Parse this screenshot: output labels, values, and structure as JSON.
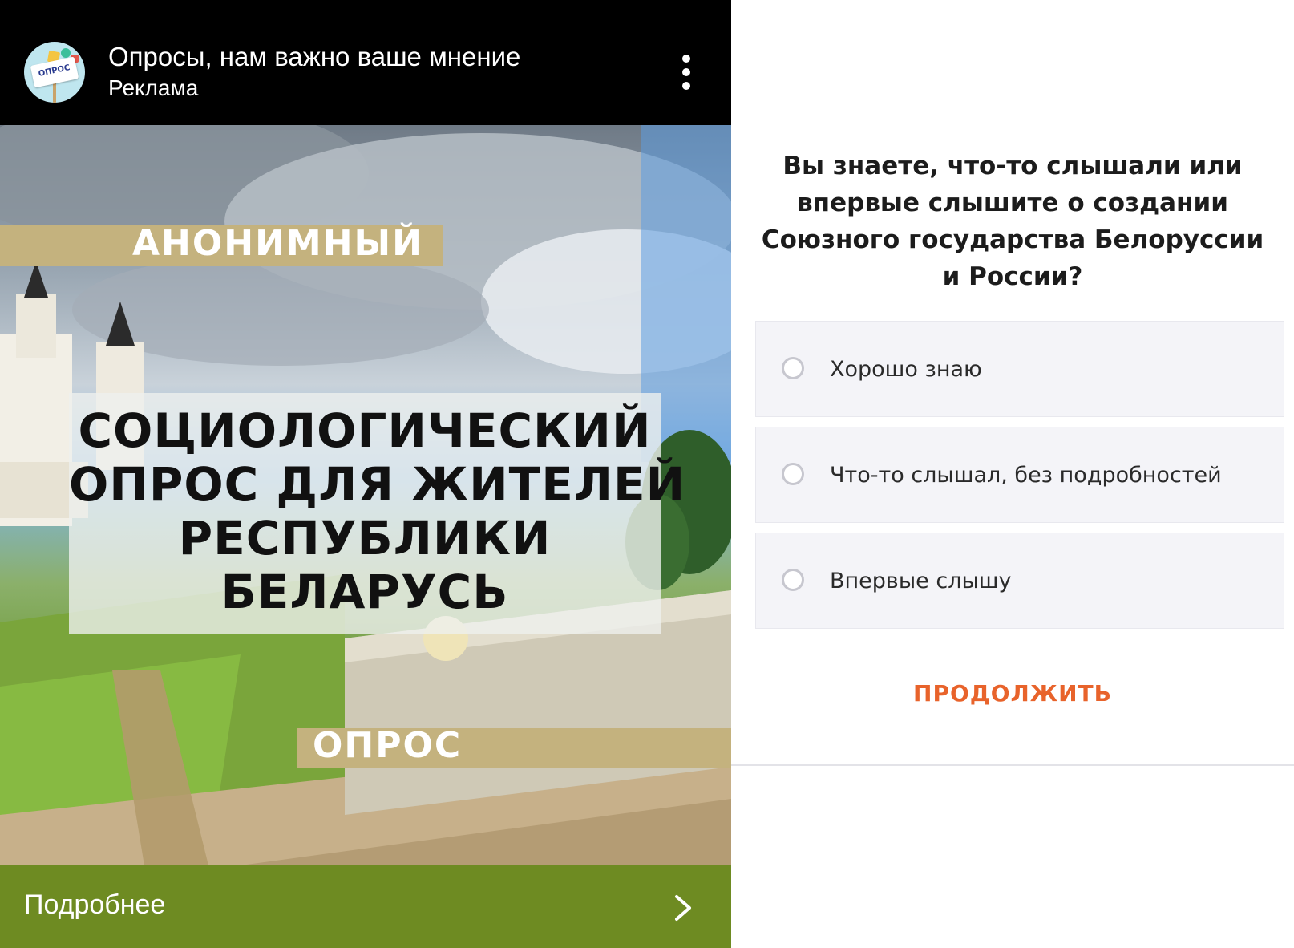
{
  "ad": {
    "title": "Опросы, нам важно ваше мнение",
    "subtitle": "Реклама",
    "avatar_text": "ОПРОС",
    "image": {
      "band_top": "АНОНИМНЫЙ",
      "headline_lines": [
        "СОЦИОЛОГИЧЕСКИЙ",
        "ОПРОС ДЛЯ ЖИТЕЛЕЙ",
        "РЕСПУБЛИКИ",
        "БЕЛАРУСЬ"
      ],
      "band_bottom": "ОПРОС"
    },
    "footer_label": "Подробнее",
    "icons": {
      "more": "more-vertical-icon",
      "chevron": "chevron-right-icon"
    },
    "colors": {
      "footer": "#6e8b22",
      "band": "#c4b27e"
    }
  },
  "survey": {
    "question": "Вы знаете, что-то слышали или впервые слышите о создании Союзного государства Белоруссии и России?",
    "options": [
      {
        "label": "Хорошо знаю"
      },
      {
        "label": "Что-то слышал, без подробностей"
      },
      {
        "label": "Впервые слышу"
      }
    ],
    "continue_label": "ПРОДОЛЖИТЬ",
    "colors": {
      "accent": "#e8632b",
      "option_bg": "#f4f4f8"
    }
  }
}
